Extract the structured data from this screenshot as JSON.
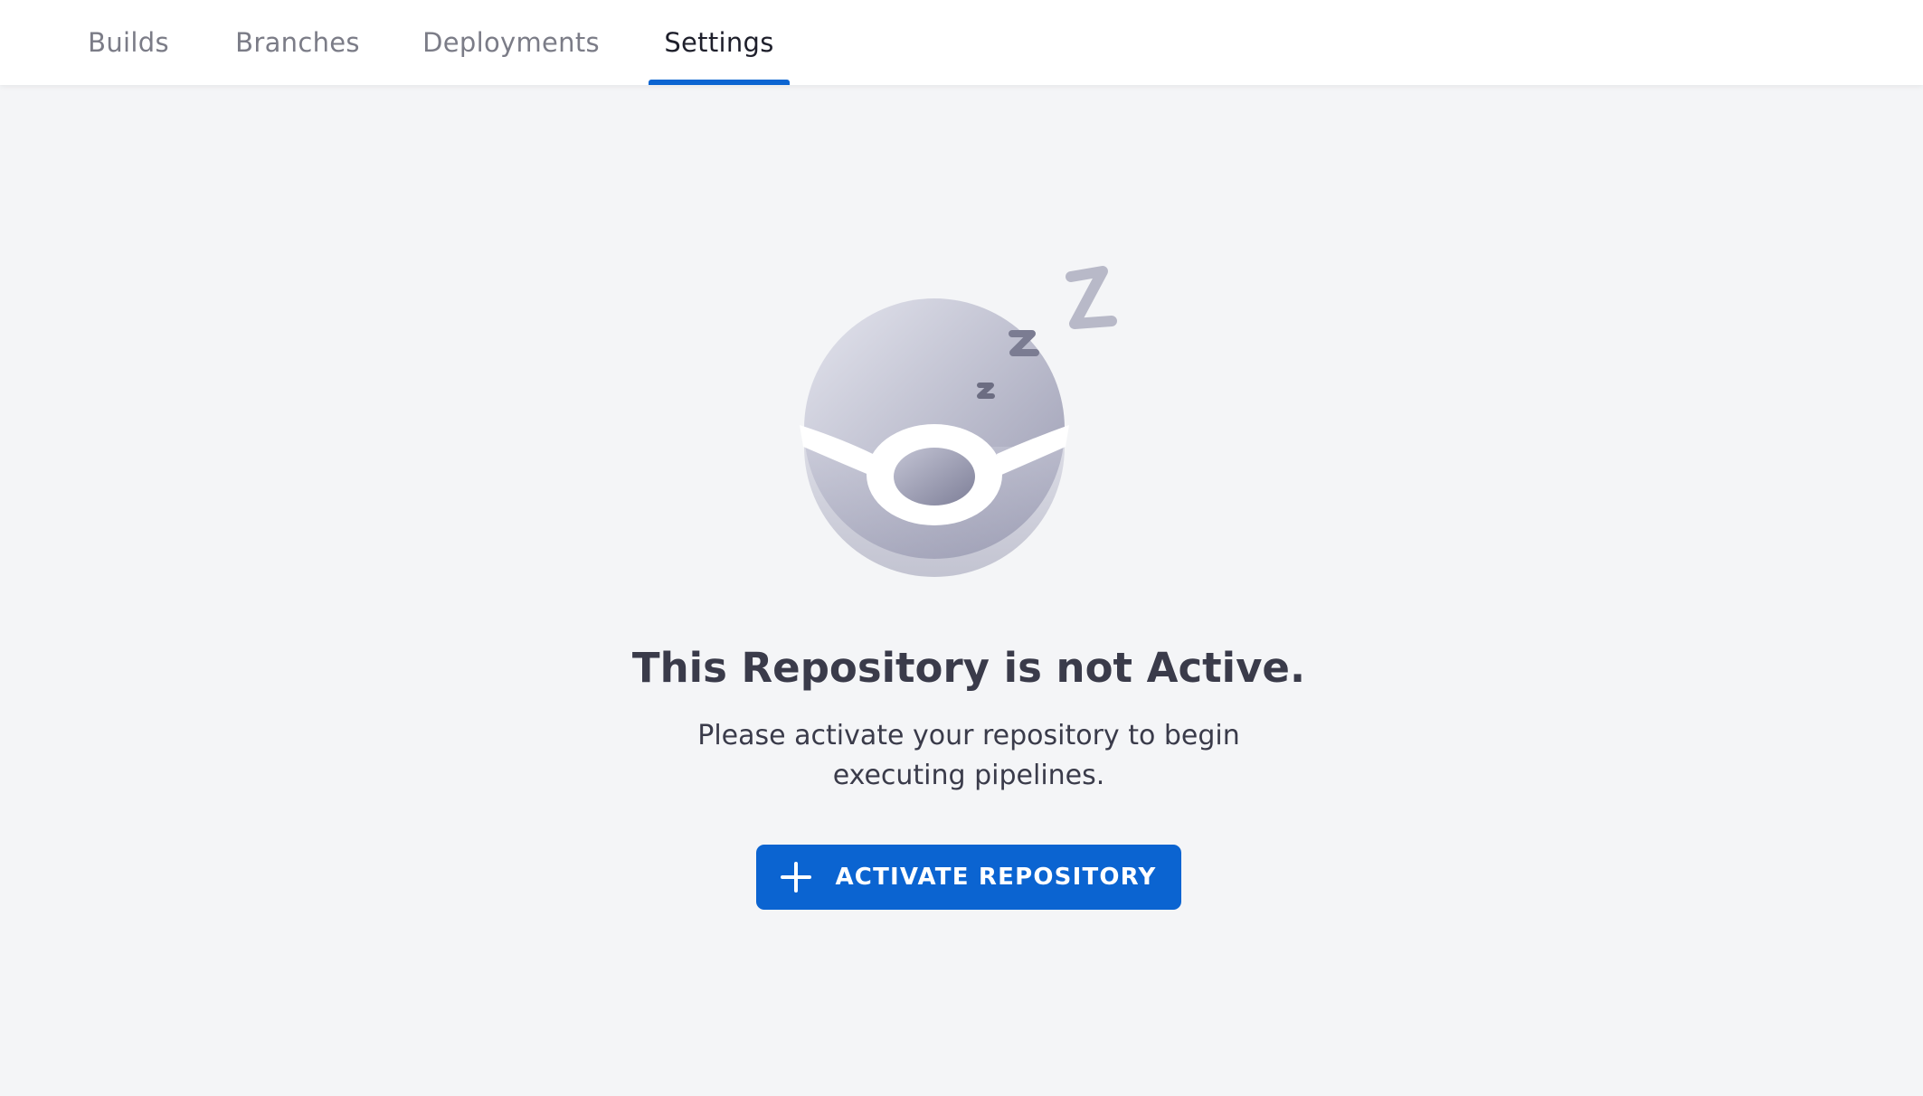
{
  "tabs": {
    "builds": "Builds",
    "branches": "Branches",
    "deployments": "Deployments",
    "settings": "Settings"
  },
  "active_tab": "settings",
  "empty_state": {
    "illustration_icon": "sleeping-ball-icon",
    "title": "This Repository is not Active.",
    "message": "Please activate your repository to begin executing pipelines.",
    "button_label": "ACTIVATE REPOSITORY",
    "button_icon": "plus-icon"
  },
  "colors": {
    "accent": "#0b64d1",
    "text_primary": "#1e1f2b",
    "text_muted": "#7b7c87",
    "heading": "#3a3b4a",
    "background": "#f4f5f7"
  }
}
